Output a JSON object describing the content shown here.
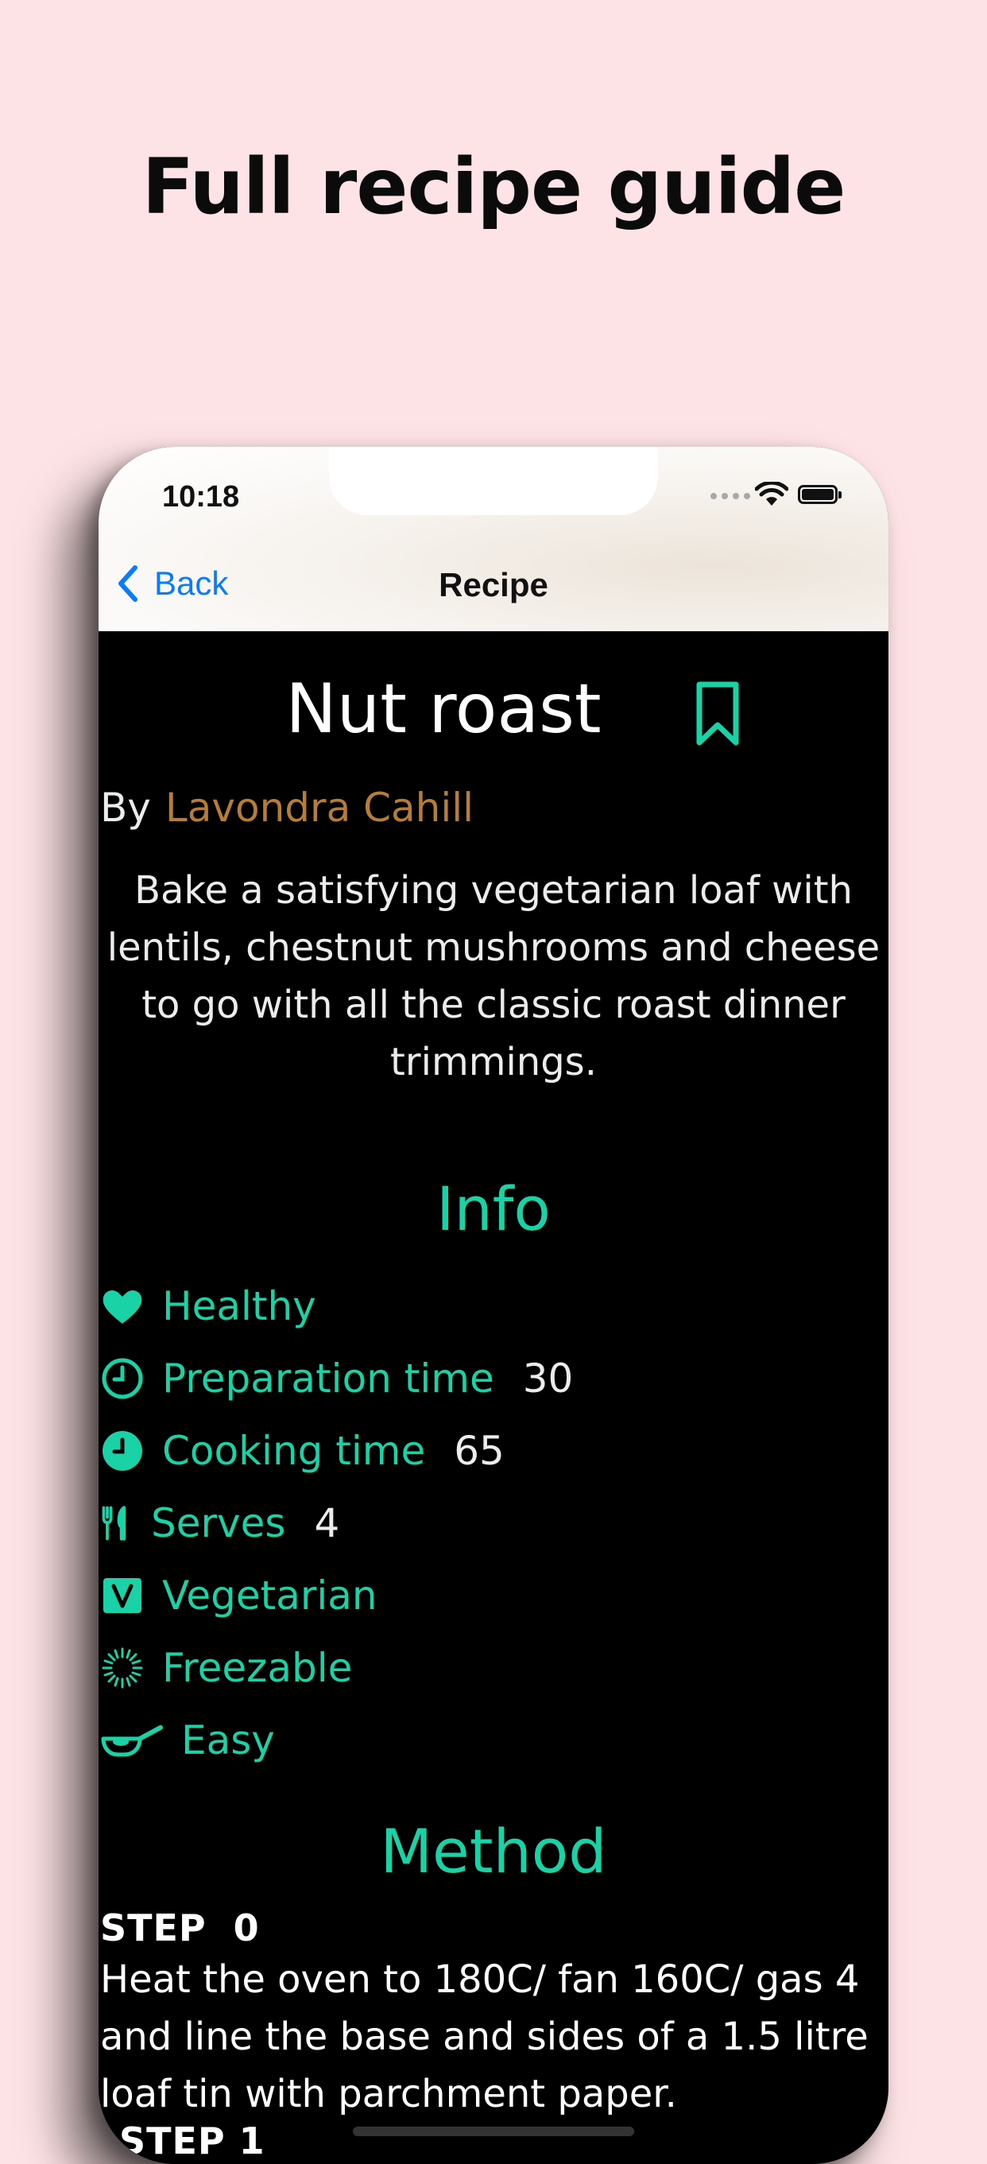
{
  "headline": "Full recipe guide",
  "status_bar": {
    "time": "10:18"
  },
  "nav": {
    "back_label": "Back",
    "title": "Recipe"
  },
  "recipe": {
    "title": "Nut roast",
    "by_label": "By",
    "author": "Lavondra Cahill",
    "description": "Bake a satisfying vegetarian loaf with lentils, chestnut mushrooms and cheese to go with all the classic roast dinner trimmings."
  },
  "info": {
    "heading": "Info",
    "items": [
      {
        "icon": "heart-icon",
        "label": "Healthy",
        "value": ""
      },
      {
        "icon": "clock-outline-icon",
        "label": "Preparation time",
        "value": "30"
      },
      {
        "icon": "clock-filled-icon",
        "label": "Cooking time",
        "value": "65"
      },
      {
        "icon": "fork-knife-icon",
        "label": "Serves",
        "value": "4"
      },
      {
        "icon": "vegetarian-icon",
        "label": "Vegetarian",
        "value": ""
      },
      {
        "icon": "snowflake-icon",
        "label": "Freezable",
        "value": ""
      },
      {
        "icon": "pan-icon",
        "label": "Easy",
        "value": ""
      }
    ]
  },
  "method": {
    "heading": "Method",
    "steps": [
      {
        "label": "STEP  0",
        "text": "Heat the oven to 180C/ fan 160C/ gas 4 and line the base and sides of a 1.5 litre loaf tin with parchment paper."
      },
      {
        "label": "STEP 1",
        "text": ""
      }
    ]
  },
  "colors": {
    "background": "#fde3e5",
    "accent": "#19d3a7",
    "author": "#b77c35",
    "link": "#0a7aff",
    "screen": "#000000"
  }
}
